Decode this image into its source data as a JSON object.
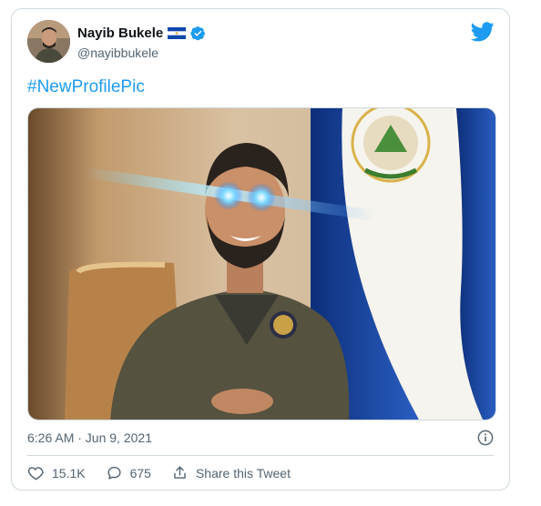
{
  "tweet": {
    "author": {
      "display_name": "Nayib Bukele",
      "handle": "@nayibbukele",
      "verified": true,
      "flag": "El Salvador flag"
    },
    "text": "#NewProfilePic",
    "timestamp": "6:26 AM · Jun 9, 2021",
    "media_alt": "Photo of a smiling man in an olive shirt with glowing laser eyes, seated in front of the flag of El Salvador"
  },
  "actions": {
    "likes": "15.1K",
    "replies": "675",
    "share_label": "Share this Tweet"
  },
  "colors": {
    "accent": "#1d9bf0",
    "verified": "#1d9bf0",
    "muted": "#536471",
    "border": "#cfd9de"
  },
  "icons": [
    "twitter-bird-icon",
    "verified-badge-icon",
    "flag-icon",
    "info-icon",
    "heart-icon",
    "reply-icon",
    "share-icon"
  ]
}
